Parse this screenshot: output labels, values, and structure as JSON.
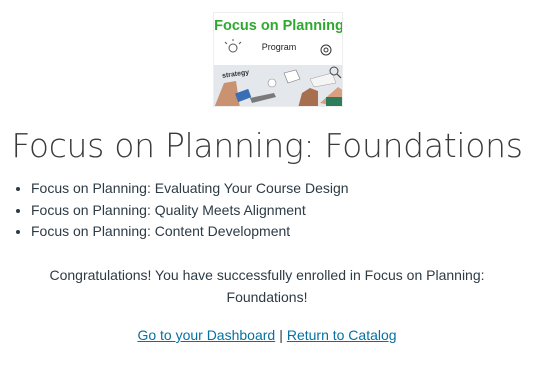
{
  "banner": {
    "title": "Focus on Planning",
    "subtitle": "Program",
    "desk_word": "strategy",
    "accent_color": "#2fa82f"
  },
  "heading": "Focus on Planning: Foundations",
  "courses": [
    "Focus on Planning: Evaluating Your Course Design",
    "Focus on Planning: Quality Meets Alignment",
    "Focus on Planning: Content Development"
  ],
  "message": "Congratulations! You have successfully enrolled in Focus on Planning: Foundations!",
  "links": {
    "dashboard": "Go to your Dashboard",
    "separator": "|",
    "catalog": "Return to Catalog",
    "color": "#0770a3"
  }
}
